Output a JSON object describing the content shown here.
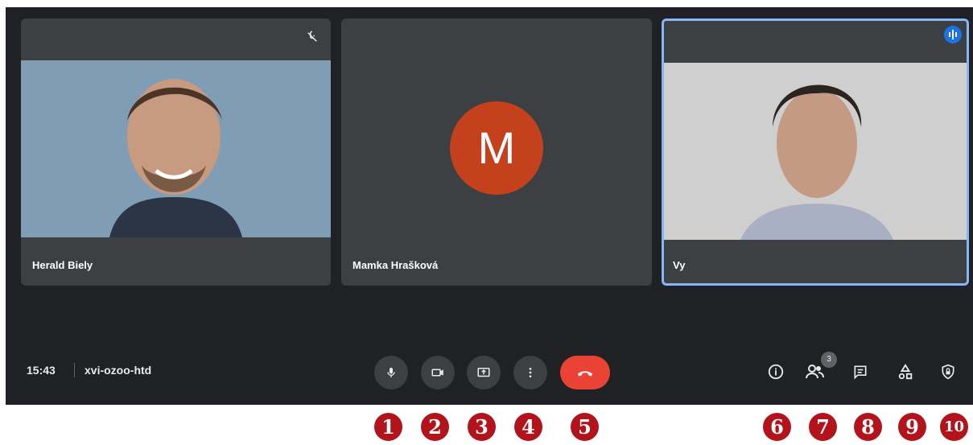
{
  "participants": [
    {
      "name": "Herald Biely"
    },
    {
      "name": "Mamka Hrašková",
      "initial": "M"
    },
    {
      "name": "Vy"
    }
  ],
  "bottom_bar": {
    "time": "15:43",
    "meeting_code": "xvi-ozoo-htd",
    "participant_count": "3"
  },
  "controls": [
    {
      "icon": "microphone-icon"
    },
    {
      "icon": "camera-icon"
    },
    {
      "icon": "present-screen-icon"
    },
    {
      "icon": "more-options-icon"
    },
    {
      "icon": "hang-up-icon"
    }
  ],
  "right_icons": [
    "info-icon",
    "people-icon",
    "chat-icon",
    "activities-icon",
    "host-controls-icon"
  ],
  "markers": [
    "1",
    "2",
    "3",
    "4",
    "5",
    "6",
    "7",
    "8",
    "9",
    "10"
  ],
  "colors": {
    "background": "#202124",
    "tile": "#3c4043",
    "active_border": "#8ab4f8",
    "hangup": "#ea4335",
    "avatar": "#c5401c",
    "marker": "#b3131b"
  }
}
